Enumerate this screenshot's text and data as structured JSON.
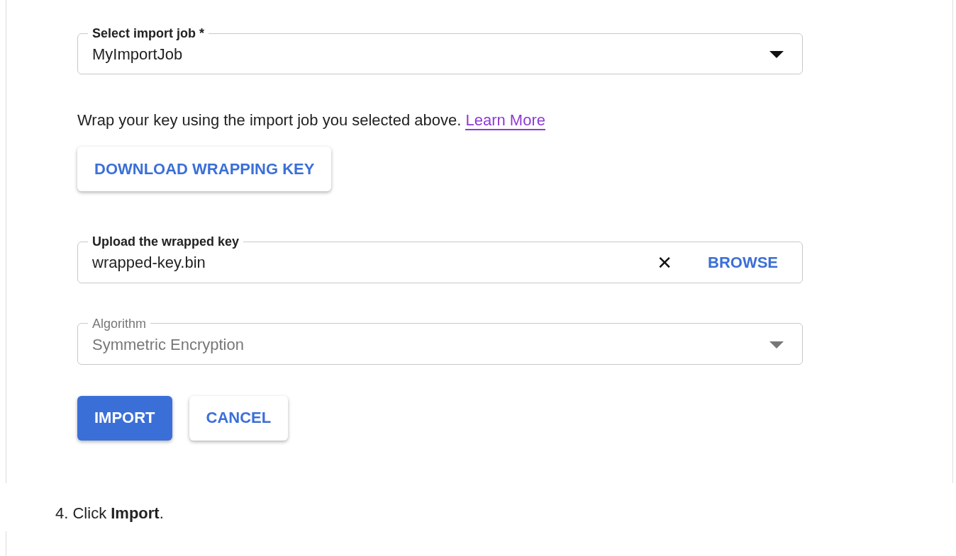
{
  "form": [
    {
      "kind": "select",
      "label": "Select import job *",
      "value": "MyImportJob",
      "disabled": false
    },
    {
      "kind": "paragraph",
      "text": "Wrap your key using the import job you selected above.",
      "link": "Learn More"
    },
    {
      "kind": "button",
      "label": "DOWNLOAD WRAPPING KEY"
    },
    {
      "kind": "file",
      "label": "Upload the wrapped key",
      "value": "wrapped-key.bin",
      "clear": "✕",
      "browse": "BROWSE"
    },
    {
      "kind": "select",
      "label": "Algorithm",
      "value": "Symmetric Encryption",
      "disabled": true
    },
    {
      "kind": "actions",
      "buttons": [
        {
          "label": "IMPORT",
          "primary": true
        },
        {
          "label": "CANCEL",
          "primary": false
        }
      ]
    }
  ],
  "step": {
    "number": "4.",
    "text": "Click **Import**."
  }
}
